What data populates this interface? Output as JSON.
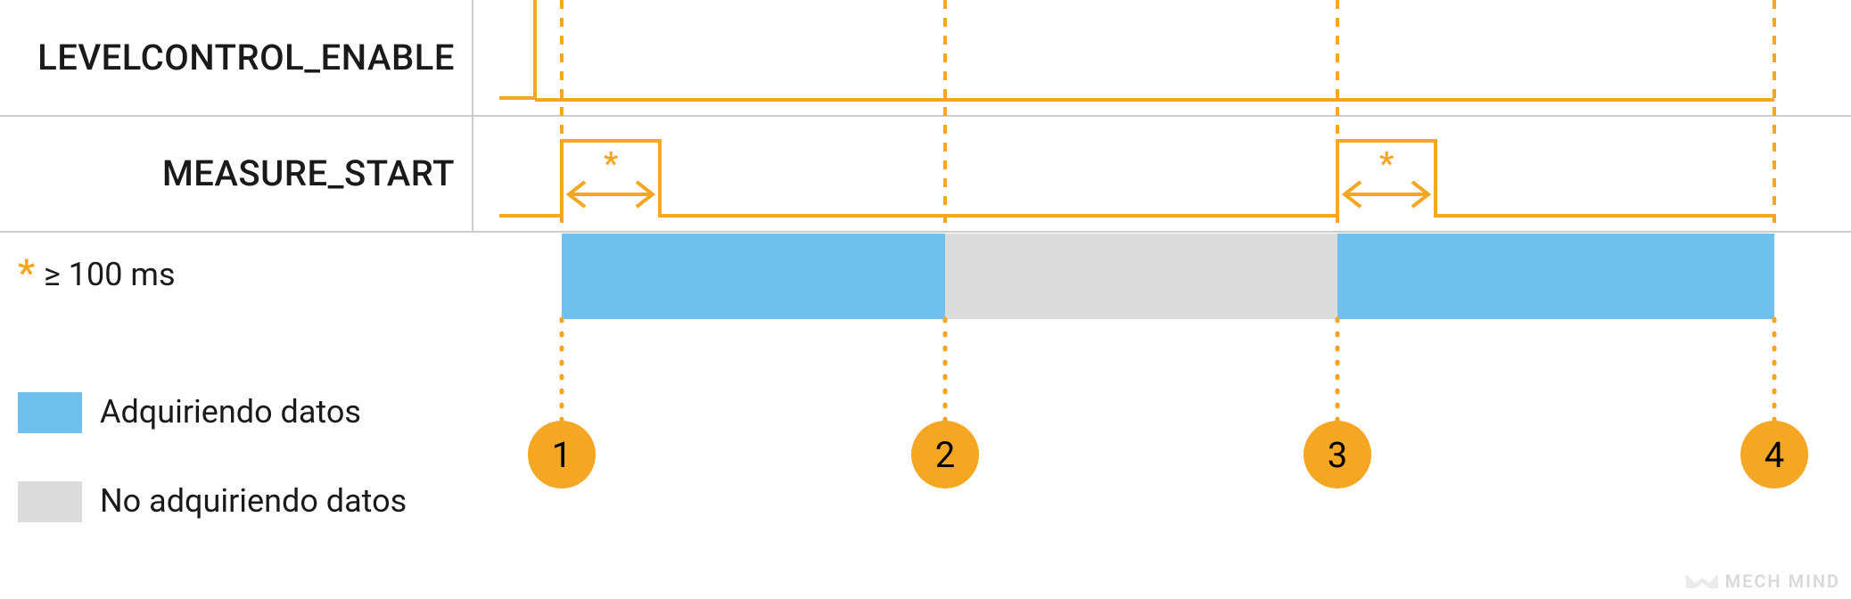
{
  "rows": {
    "level_enable": "LEVELCONTROL_ENABLE",
    "measure_start": "MEASURE_START"
  },
  "note": {
    "asterisk": "*",
    "text": "≥ 100 ms"
  },
  "legend": {
    "acquiring": "Adquiriendo datos",
    "not_acquiring": "No adquiriendo datos"
  },
  "markers": [
    "1",
    "2",
    "3",
    "4"
  ],
  "colors": {
    "orange": "#f5a623",
    "blue": "#6fc0ea",
    "grey": "#dcdcdc"
  },
  "watermark": "MECH MIND",
  "chart_data": {
    "type": "timing-diagram",
    "signals": [
      {
        "name": "LEVELCONTROL_ENABLE",
        "events": [
          {
            "t": 1,
            "level": "high"
          },
          {
            "t": 4,
            "level": "high"
          }
        ],
        "description": "Goes high just before marker 1 and remains high through marker 4."
      },
      {
        "name": "MEASURE_START",
        "events": [
          {
            "t": 1,
            "edge": "rising",
            "min_high_ms": 100
          },
          {
            "t": "1+",
            "edge": "falling"
          },
          {
            "t": 3,
            "edge": "rising",
            "min_high_ms": 100
          },
          {
            "t": "3+",
            "edge": "falling"
          }
        ],
        "description": "Short high pulses (≥100 ms) starting at markers 1 and 3."
      }
    ],
    "acquisition_intervals": [
      {
        "from": 1,
        "to": 2,
        "state": "acquiring"
      },
      {
        "from": 2,
        "to": 3,
        "state": "not_acquiring"
      },
      {
        "from": 3,
        "to": 4,
        "state": "acquiring"
      }
    ],
    "constraint": "MEASURE_START high pulse width ≥ 100 ms",
    "markers": [
      1,
      2,
      3,
      4
    ]
  }
}
